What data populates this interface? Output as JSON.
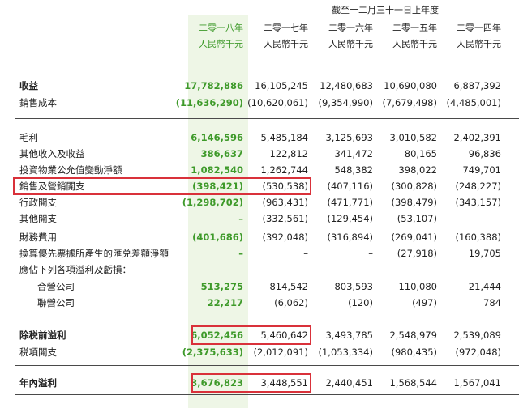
{
  "period_header": "截至十二月三十一日止年度",
  "columns": [
    {
      "year": "二零一八年",
      "unit": "人民幣千元"
    },
    {
      "year": "二零一七年",
      "unit": "人民幣千元"
    },
    {
      "year": "二零一六年",
      "unit": "人民幣千元"
    },
    {
      "year": "二零一五年",
      "unit": "人民幣千元"
    },
    {
      "year": "二零一四年",
      "unit": "人民幣千元"
    }
  ],
  "rows": [
    {
      "label": "收益",
      "bold": true,
      "values": [
        "17,782,886",
        "16,105,245",
        "12,480,683",
        "10,690,080",
        "6,887,392"
      ]
    },
    {
      "label": "銷售成本",
      "values": [
        "(11,636,290)",
        "(10,620,061)",
        "(9,354,990)",
        "(7,679,498)",
        "(4,485,001)"
      ]
    },
    {
      "label": "毛利",
      "values": [
        "6,146,596",
        "5,485,184",
        "3,125,693",
        "3,010,582",
        "2,402,391"
      ]
    },
    {
      "label": "其他收入及收益",
      "values": [
        "386,637",
        "122,812",
        "341,472",
        "80,165",
        "96,836"
      ]
    },
    {
      "label": "投資物業公允值變動淨額",
      "values": [
        "1,082,540",
        "1,262,744",
        "548,382",
        "398,022",
        "749,701"
      ]
    },
    {
      "label": "銷售及營銷開支",
      "values": [
        "(398,421)",
        "(530,538)",
        "(407,116)",
        "(300,828)",
        "(248,227)"
      ]
    },
    {
      "label": "行政開支",
      "values": [
        "(1,298,702)",
        "(963,431)",
        "(471,771)",
        "(398,479)",
        "(343,157)"
      ]
    },
    {
      "label": "其他開支",
      "values": [
        "–",
        "(332,561)",
        "(129,454)",
        "(53,107)",
        "–"
      ]
    },
    {
      "label": "財務費用",
      "values": [
        "(401,686)",
        "(392,048)",
        "(316,894)",
        "(269,041)",
        "(160,388)"
      ]
    },
    {
      "label": "換算優先票據所產生的匯兑差額淨額",
      "values": [
        "–",
        "–",
        "–",
        "(27,918)",
        "19,705"
      ]
    },
    {
      "label": "應佔下列各項溢利及虧損：",
      "values": [
        "",
        "",
        "",
        "",
        ""
      ]
    },
    {
      "label": "合營公司",
      "values": [
        "513,275",
        "814,542",
        "803,593",
        "110,080",
        "21,444"
      ]
    },
    {
      "label": "聯營公司",
      "values": [
        "22,217",
        "(6,062)",
        "(120)",
        "(497)",
        "784"
      ]
    },
    {
      "label": "除税前溢利",
      "bold": true,
      "values": [
        "6,052,456",
        "5,460,642",
        "3,493,785",
        "2,548,979",
        "2,539,089"
      ]
    },
    {
      "label": "税項開支",
      "values": [
        "(2,375,633)",
        "(2,012,091)",
        "(1,053,334)",
        "(980,435)",
        "(972,048)"
      ]
    },
    {
      "label": "年內溢利",
      "bold": true,
      "values": [
        "3,676,823",
        "3,448,551",
        "2,440,451",
        "1,568,544",
        "1,567,041"
      ]
    }
  ],
  "colors": {
    "accent_green": "#3e9a2a",
    "highlight_bg": "#eef6e6",
    "annotation_red": "#d9313a"
  }
}
